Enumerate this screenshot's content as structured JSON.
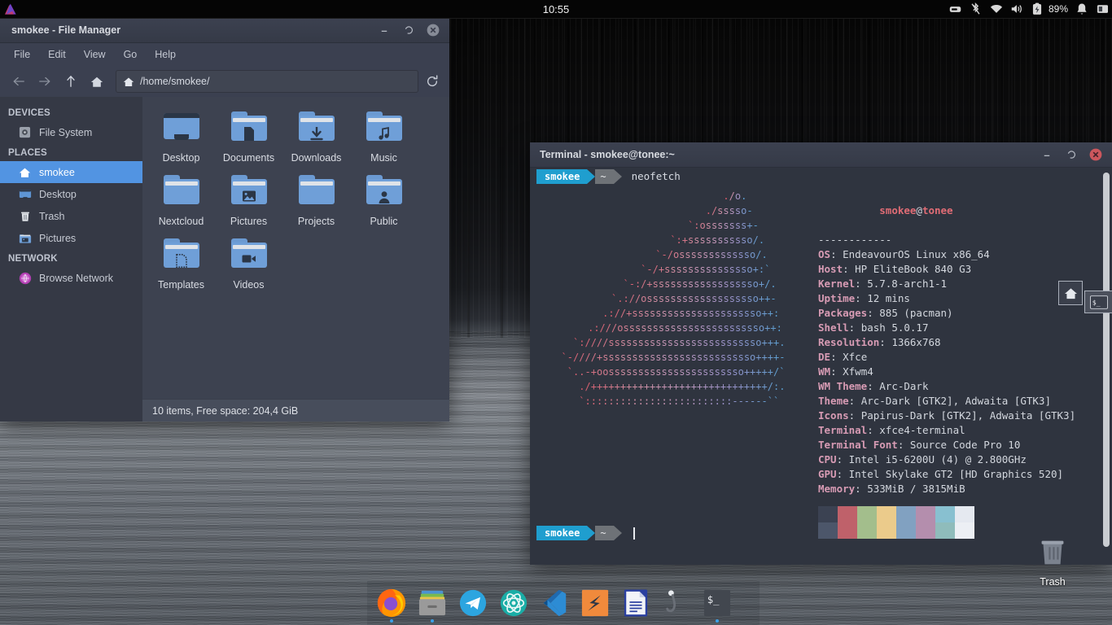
{
  "top_panel": {
    "logo_icon": "endeavouros-logo-icon",
    "clock": "10:55",
    "tray": [
      {
        "name": "keyboard-layout-icon",
        "glyph": "⌨"
      },
      {
        "name": "bluetooth-disabled-icon",
        "glyph": "ᛦ"
      },
      {
        "name": "wifi-icon",
        "glyph": "▲"
      },
      {
        "name": "volume-icon",
        "glyph": "▶"
      },
      {
        "name": "battery-charging-icon",
        "glyph": "⚡"
      }
    ],
    "battery_text": "89%",
    "notification_icon": "bell-icon",
    "display_icon": "display-icon"
  },
  "file_manager": {
    "title": "smokee - File Manager",
    "window_buttons": {
      "minimize": "–",
      "maximize": "❐",
      "close": "✕"
    },
    "menu": [
      "File",
      "Edit",
      "View",
      "Go",
      "Help"
    ],
    "toolbar": {
      "back_icon": "arrow-left-icon",
      "forward_icon": "arrow-right-icon",
      "up_icon": "arrow-up-icon",
      "home_icon": "home-icon",
      "reload_icon": "reload-icon",
      "path_value": "/home/smokee/",
      "path_icon": "home-icon"
    },
    "sidebar": [
      {
        "type": "header",
        "label": "DEVICES"
      },
      {
        "type": "item",
        "label": "File System",
        "icon": "drive-icon",
        "active": false
      },
      {
        "type": "header",
        "label": "PLACES"
      },
      {
        "type": "item",
        "label": "smokee",
        "icon": "home-icon",
        "active": true
      },
      {
        "type": "item",
        "label": "Desktop",
        "icon": "desktop-icon",
        "active": false
      },
      {
        "type": "item",
        "label": "Trash",
        "icon": "trash-icon",
        "active": false
      },
      {
        "type": "item",
        "label": "Pictures",
        "icon": "pictures-folder-icon",
        "active": false
      },
      {
        "type": "header",
        "label": "NETWORK"
      },
      {
        "type": "item",
        "label": "Browse Network",
        "icon": "globe-icon",
        "active": false
      }
    ],
    "files": [
      {
        "label": "Desktop",
        "icon": "desktop-folder-icon",
        "glyph": ""
      },
      {
        "label": "Documents",
        "icon": "documents-folder-icon",
        "glyph": "▮"
      },
      {
        "label": "Downloads",
        "icon": "downloads-folder-icon",
        "glyph": "↓"
      },
      {
        "label": "Music",
        "icon": "music-folder-icon",
        "glyph": "♫"
      },
      {
        "label": "Nextcloud",
        "icon": "folder-icon",
        "glyph": ""
      },
      {
        "label": "Pictures",
        "icon": "pictures-folder-icon",
        "glyph": "▣"
      },
      {
        "label": "Projects",
        "icon": "folder-icon",
        "glyph": ""
      },
      {
        "label": "Public",
        "icon": "public-folder-icon",
        "glyph": "●"
      },
      {
        "label": "Templates",
        "icon": "templates-folder-icon",
        "glyph": "▯"
      },
      {
        "label": "Videos",
        "icon": "videos-folder-icon",
        "glyph": "▶"
      }
    ],
    "status": "10 items, Free space: 204,4 GiB"
  },
  "terminal": {
    "title": "Terminal - smokee@tonee:~",
    "window_buttons": {
      "minimize": "–",
      "maximize": "❐",
      "close": "✕"
    },
    "prompt_user": "smokee",
    "prompt_dir": "~",
    "command": "neofetch",
    "ascii_art": [
      "                     ./o.",
      "                   ./sssso-",
      "                 `:osssssss+-",
      "               `:+sssssssssso/.",
      "             `-/osssssssssssso/.",
      "           `-/+sssssssssssssso+:`",
      "         `-:/+ssssssssssssssssso+/.",
      "       `.://osssssssssssssssssso++-",
      "      .://+ssssssssssssssssssssso++:",
      "    .:///ossssssssssssssssssssssso++:",
      "  `:////ssssssssssssssssssssssssso+++.",
      "`-////+ssssssssssssssssssssssssso++++-",
      " `..-+oosssssssssssssssssssssso+++++/`",
      "   ./++++++++++++++++++++++++++++++/:.",
      "  `:::::::::::::::::::::::::------``"
    ],
    "fetch": {
      "user": "smokee",
      "host": "tonee",
      "separator": "------------",
      "rows": [
        {
          "key": "OS",
          "value": "EndeavourOS Linux x86_64"
        },
        {
          "key": "Host",
          "value": "HP EliteBook 840 G3"
        },
        {
          "key": "Kernel",
          "value": "5.7.8-arch1-1"
        },
        {
          "key": "Uptime",
          "value": "12 mins"
        },
        {
          "key": "Packages",
          "value": "885 (pacman)"
        },
        {
          "key": "Shell",
          "value": "bash 5.0.17"
        },
        {
          "key": "Resolution",
          "value": "1366x768"
        },
        {
          "key": "DE",
          "value": "Xfce"
        },
        {
          "key": "WM",
          "value": "Xfwm4"
        },
        {
          "key": "WM Theme",
          "value": "Arc-Dark"
        },
        {
          "key": "Theme",
          "value": "Arc-Dark [GTK2], Adwaita [GTK3]"
        },
        {
          "key": "Icons",
          "value": "Papirus-Dark [GTK2], Adwaita [GTK3]"
        },
        {
          "key": "Terminal",
          "value": "xfce4-terminal"
        },
        {
          "key": "Terminal Font",
          "value": "Source Code Pro 10"
        },
        {
          "key": "CPU",
          "value": "Intel i5-6200U (4) @ 2.800GHz"
        },
        {
          "key": "GPU",
          "value": "Intel Skylake GT2 [HD Graphics 520]"
        },
        {
          "key": "Memory",
          "value": "533MiB / 3815MiB"
        }
      ],
      "palette_top": [
        "#3b4252",
        "#bf616a",
        "#a3be8c",
        "#ebcb8b",
        "#81a1c1",
        "#b48ead",
        "#88c0d0",
        "#e5e9f0"
      ],
      "palette_bottom": [
        "#4c566a",
        "#bf616a",
        "#a3be8c",
        "#ebcb8b",
        "#81a1c1",
        "#b48ead",
        "#8fbcbb",
        "#eceff4"
      ]
    }
  },
  "switcher": {
    "items": [
      {
        "name": "home-icon",
        "glyph": "⌂"
      },
      {
        "name": "terminal-icon",
        "glyph": "$_"
      }
    ]
  },
  "desktop": {
    "trash_label": "Trash",
    "trash_icon": "trash-icon"
  },
  "dock": {
    "items": [
      {
        "name": "firefox",
        "icon": "firefox-icon",
        "running": true
      },
      {
        "name": "file-manager",
        "icon": "file-manager-icon",
        "running": true
      },
      {
        "name": "telegram",
        "icon": "telegram-icon",
        "running": false
      },
      {
        "name": "atom",
        "icon": "atom-icon",
        "running": false
      },
      {
        "name": "vscode",
        "icon": "vscode-icon",
        "running": false
      },
      {
        "name": "octave",
        "icon": "octave-icon",
        "running": false
      },
      {
        "name": "libreoffice-writer",
        "icon": "libreoffice-writer-icon",
        "running": false
      },
      {
        "name": "inkscape",
        "icon": "hook-icon",
        "running": false
      },
      {
        "name": "terminal",
        "icon": "terminal-icon",
        "running": true
      }
    ]
  },
  "colors": {
    "accent": "#5294e2",
    "terminal_bg": "#2f343f",
    "window_bg": "#383c4a",
    "prompt_user_bg": "#1f9ecf",
    "close_red": "#cc575d",
    "neofetch_key": "#d79bb4"
  }
}
